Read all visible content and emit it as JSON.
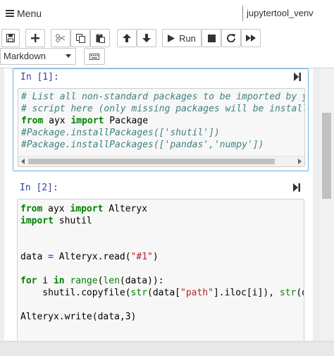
{
  "header": {
    "menu_label": "Menu",
    "kernel_name": "jupytertool_venv"
  },
  "toolbar": {
    "buttons": [
      {
        "name": "save",
        "icon": "save-icon"
      },
      {
        "name": "insert-cell",
        "icon": "plus-icon"
      },
      {
        "name": "cut",
        "icon": "scissors-icon"
      },
      {
        "name": "copy",
        "icon": "copy-icon"
      },
      {
        "name": "paste",
        "icon": "paste-icon"
      },
      {
        "name": "move-up",
        "icon": "arrow-up-icon"
      },
      {
        "name": "move-down",
        "icon": "arrow-down-icon"
      },
      {
        "name": "run",
        "icon": "play-icon",
        "label": "Run"
      },
      {
        "name": "stop",
        "icon": "stop-icon"
      },
      {
        "name": "restart",
        "icon": "restart-icon"
      },
      {
        "name": "fast-forward",
        "icon": "fast-forward-icon"
      }
    ],
    "run_label": "Run",
    "cell_type": "Markdown"
  },
  "cells": [
    {
      "prompt": "In [1]:",
      "lines": [
        "# List all non-standard packages to be imported by your",
        "# script here (only missing packages will be installed)",
        "from ayx import Package",
        "#Package.installPackages(['shutil'])",
        "#Package.installPackages(['pandas','numpy'])"
      ]
    },
    {
      "prompt": "In [2]:",
      "lines": [
        "from ayx import Alteryx",
        "import shutil",
        "",
        "",
        "data = Alteryx.read(\"#1\")",
        "",
        "for i in range(len(data)):",
        "    shutil.copyfile(str(data[\"path\"].iloc[i]), str(data",
        "",
        "Alteryx.write(data,3)"
      ]
    }
  ],
  "colors": {
    "prompt": "#303f9f",
    "keyword": "#008000",
    "comment": "#408080",
    "string": "#ba2121",
    "selected_border": "#66afe9"
  }
}
